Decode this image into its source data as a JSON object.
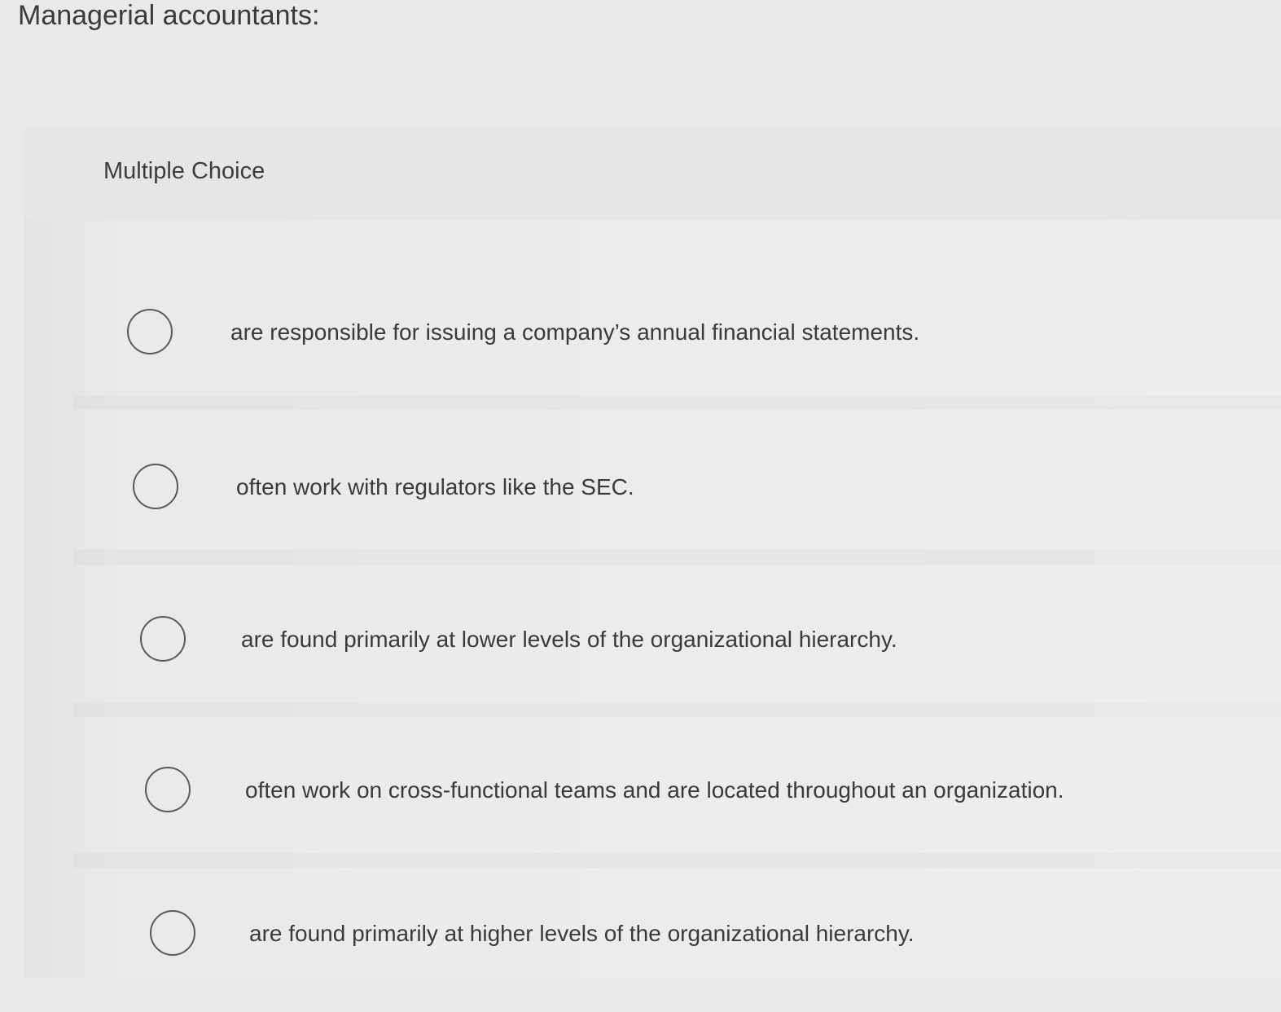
{
  "question": {
    "title": "Managerial accountants:"
  },
  "panel": {
    "type_label": "Multiple Choice"
  },
  "options": [
    {
      "text": "are responsible for issuing a company’s annual financial statements."
    },
    {
      "text": "often work with regulators like the SEC."
    },
    {
      "text": "are found primarily at lower levels of the organizational hierarchy."
    },
    {
      "text": "often work on cross-functional teams and are located throughout an organization."
    },
    {
      "text": "are found primarily at higher levels of the organizational hierarchy."
    }
  ]
}
